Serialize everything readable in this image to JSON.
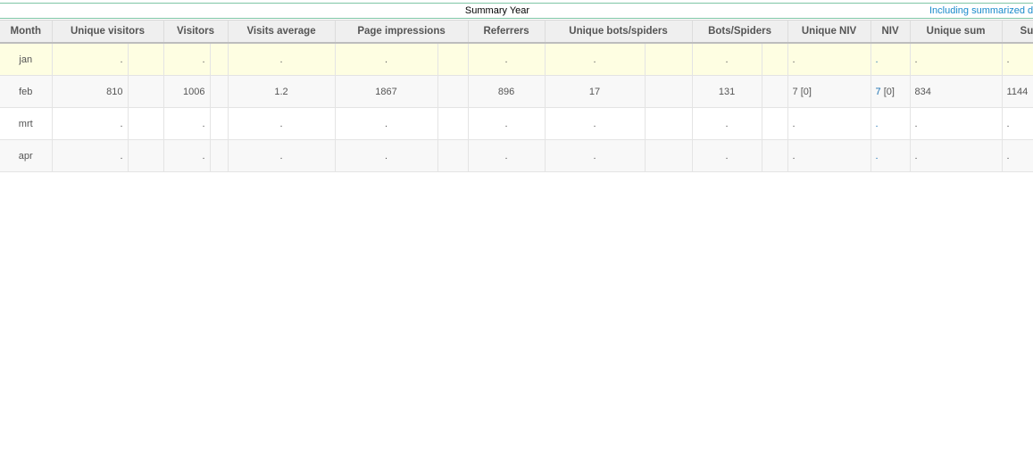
{
  "summary": {
    "title": "Summary Year",
    "note": "Including summarized da"
  },
  "headers": {
    "month": "Month",
    "unique_visitors": "Unique visitors",
    "visitors": "Visitors",
    "visits_average": "Visits average",
    "page_impressions": "Page impressions",
    "referrers": "Referrers",
    "unique_bots": "Unique bots/spiders",
    "bots": "Bots/Spiders",
    "unique_niv": "Unique NIV",
    "niv": "NIV",
    "unique_sum": "Unique sum",
    "sum": "Su"
  },
  "rows": [
    {
      "month": "jan",
      "unique_visitors": ".",
      "visitors": ".",
      "visits_average": ".",
      "page_impressions": ".",
      "referrers": ".",
      "unique_bots": ".",
      "bots": ".",
      "unique_niv": ".",
      "niv_value": ".",
      "niv_extra": "",
      "unique_sum": ".",
      "sum": "."
    },
    {
      "month": "feb",
      "unique_visitors": "810",
      "visitors": "1006",
      "visits_average": "1.2",
      "page_impressions": "1867",
      "referrers": "896",
      "unique_bots": "17",
      "bots": "131",
      "unique_niv": "7 [0]",
      "niv_value": "7",
      "niv_extra": " [0]",
      "unique_sum": "834",
      "sum": "1144"
    },
    {
      "month": "mrt",
      "unique_visitors": ".",
      "visitors": ".",
      "visits_average": ".",
      "page_impressions": ".",
      "referrers": ".",
      "unique_bots": ".",
      "bots": ".",
      "unique_niv": ".",
      "niv_value": ".",
      "niv_extra": "",
      "unique_sum": ".",
      "sum": "."
    },
    {
      "month": "apr",
      "unique_visitors": ".",
      "visitors": ".",
      "visits_average": ".",
      "page_impressions": ".",
      "referrers": ".",
      "unique_bots": ".",
      "bots": ".",
      "unique_niv": ".",
      "niv_value": ".",
      "niv_extra": "",
      "unique_sum": ".",
      "sum": "."
    }
  ]
}
